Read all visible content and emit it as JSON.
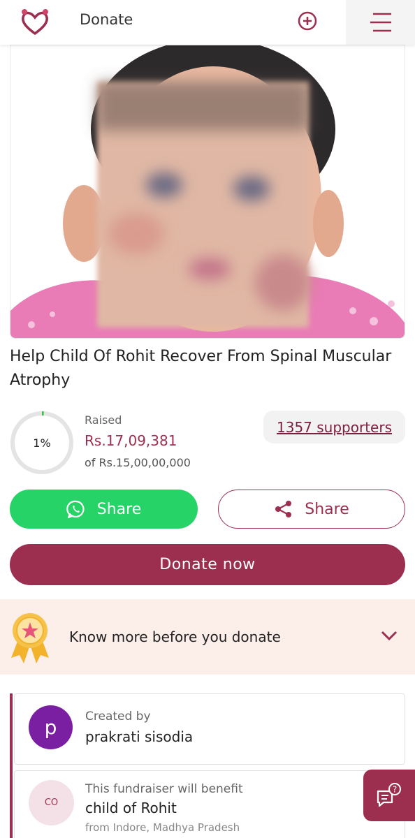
{
  "header": {
    "title": "Donate",
    "logo_icon": "hands-heart-logo-icon",
    "add_icon": "plus-circle-icon",
    "menu_icon": "hamburger-menu-icon"
  },
  "hero": {
    "image_label": "blurred child photo"
  },
  "campaign": {
    "title": "Help Child Of Rohit Recover From Spinal Muscular Atrophy",
    "progress_percent": 1,
    "progress_label": "1%",
    "raised_label": "Raised",
    "raised_amount": "Rs.17,09,381",
    "goal_text": "of Rs.15,00,00,000",
    "supporters": "1357 supporters"
  },
  "actions": {
    "whatsapp_share": "Share",
    "share": "Share",
    "donate_now": "Donate now"
  },
  "know_more": {
    "label": "Know more before you donate",
    "icon": "award-ribbon-icon"
  },
  "creator": {
    "avatar_letter": "p",
    "label": "Created by",
    "name": "prakrati sisodia"
  },
  "beneficiary": {
    "avatar_initials": "CO",
    "label": "This fundraiser will benefit",
    "name": "child of Rohit",
    "location": "from Indore, Madhya Pradesh"
  },
  "colors": {
    "brand": "#9c2f4f",
    "whatsapp": "#25d366",
    "know_more_bg": "#fcefe9"
  }
}
